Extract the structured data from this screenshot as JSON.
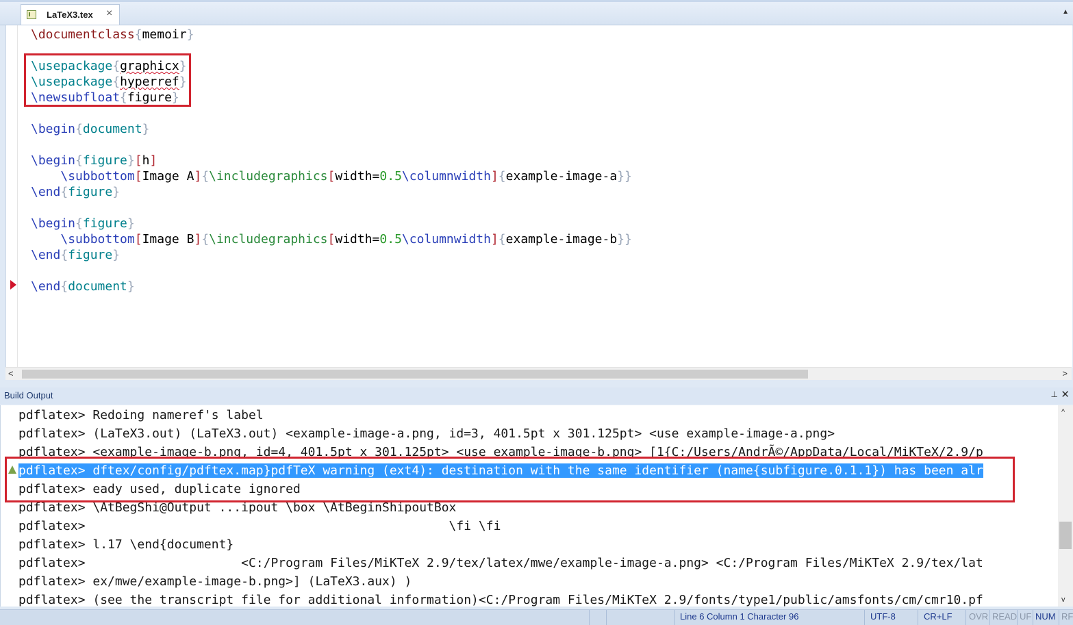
{
  "tab": {
    "label": "LaTeX3.tex"
  },
  "editor": {
    "lines": [
      {
        "parts": [
          {
            "t": "\\documentclass",
            "c": "kw-red"
          },
          {
            "t": "{",
            "c": "br-gray"
          },
          {
            "t": "memoir",
            "c": ""
          },
          {
            "t": "}",
            "c": "br-gray"
          }
        ]
      },
      {
        "parts": []
      },
      {
        "parts": [
          {
            "t": "\\usepackage",
            "c": "kw-teal"
          },
          {
            "t": "{",
            "c": "br-gray"
          },
          {
            "t": "graphicx",
            "c": "squiggle"
          },
          {
            "t": "}",
            "c": "br-gray"
          }
        ]
      },
      {
        "parts": [
          {
            "t": "\\usepackage",
            "c": "kw-teal"
          },
          {
            "t": "{",
            "c": "br-gray"
          },
          {
            "t": "hyperref",
            "c": "squiggle"
          },
          {
            "t": "}",
            "c": "br-gray"
          }
        ]
      },
      {
        "parts": [
          {
            "t": "\\newsubfloat",
            "c": "kw-blue"
          },
          {
            "t": "{",
            "c": "br-gray"
          },
          {
            "t": "figure",
            "c": ""
          },
          {
            "t": "}",
            "c": "br-gray"
          }
        ]
      },
      {
        "parts": []
      },
      {
        "parts": [
          {
            "t": "\\begin",
            "c": "kw-blue"
          },
          {
            "t": "{",
            "c": "br-gray"
          },
          {
            "t": "document",
            "c": "kw-teal"
          },
          {
            "t": "}",
            "c": "br-gray"
          }
        ]
      },
      {
        "parts": []
      },
      {
        "parts": [
          {
            "t": "\\begin",
            "c": "kw-blue"
          },
          {
            "t": "{",
            "c": "br-gray"
          },
          {
            "t": "figure",
            "c": "kw-teal"
          },
          {
            "t": "}",
            "c": "br-gray"
          },
          {
            "t": "[",
            "c": "br-red"
          },
          {
            "t": "h",
            "c": ""
          },
          {
            "t": "]",
            "c": "br-red"
          }
        ]
      },
      {
        "parts": [
          {
            "t": "    ",
            "c": ""
          },
          {
            "t": "\\subbottom",
            "c": "kw-blue"
          },
          {
            "t": "[",
            "c": "br-red"
          },
          {
            "t": "Image A",
            "c": ""
          },
          {
            "t": "]",
            "c": "br-red"
          },
          {
            "t": "{",
            "c": "br-gray"
          },
          {
            "t": "\\includegraphics",
            "c": "kw-green"
          },
          {
            "t": "[",
            "c": "br-red"
          },
          {
            "t": "width=",
            "c": ""
          },
          {
            "t": "0.5",
            "c": "num"
          },
          {
            "t": "\\columnwidth",
            "c": "kw-blue"
          },
          {
            "t": "]",
            "c": "br-red"
          },
          {
            "t": "{",
            "c": "br-gray"
          },
          {
            "t": "example-image-a",
            "c": ""
          },
          {
            "t": "}}",
            "c": "br-gray"
          }
        ]
      },
      {
        "parts": [
          {
            "t": "\\end",
            "c": "kw-blue"
          },
          {
            "t": "{",
            "c": "br-gray"
          },
          {
            "t": "figure",
            "c": "kw-teal"
          },
          {
            "t": "}",
            "c": "br-gray"
          }
        ]
      },
      {
        "parts": []
      },
      {
        "parts": [
          {
            "t": "\\begin",
            "c": "kw-blue"
          },
          {
            "t": "{",
            "c": "br-gray"
          },
          {
            "t": "figure",
            "c": "kw-teal"
          },
          {
            "t": "}",
            "c": "br-gray"
          }
        ]
      },
      {
        "parts": [
          {
            "t": "    ",
            "c": ""
          },
          {
            "t": "\\subbottom",
            "c": "kw-blue"
          },
          {
            "t": "[",
            "c": "br-red"
          },
          {
            "t": "Image B",
            "c": ""
          },
          {
            "t": "]",
            "c": "br-red"
          },
          {
            "t": "{",
            "c": "br-gray"
          },
          {
            "t": "\\includegraphics",
            "c": "kw-green"
          },
          {
            "t": "[",
            "c": "br-red"
          },
          {
            "t": "width=",
            "c": ""
          },
          {
            "t": "0.5",
            "c": "num"
          },
          {
            "t": "\\columnwidth",
            "c": "kw-blue"
          },
          {
            "t": "]",
            "c": "br-red"
          },
          {
            "t": "{",
            "c": "br-gray"
          },
          {
            "t": "example-image-b",
            "c": ""
          },
          {
            "t": "}}",
            "c": "br-gray"
          }
        ]
      },
      {
        "parts": [
          {
            "t": "\\end",
            "c": "kw-blue"
          },
          {
            "t": "{",
            "c": "br-gray"
          },
          {
            "t": "figure",
            "c": "kw-teal"
          },
          {
            "t": "}",
            "c": "br-gray"
          }
        ]
      },
      {
        "parts": []
      },
      {
        "parts": [
          {
            "t": "\\end",
            "c": "kw-blue"
          },
          {
            "t": "{",
            "c": "br-gray"
          },
          {
            "t": "document",
            "c": "kw-teal"
          },
          {
            "t": "}",
            "c": "br-gray"
          }
        ]
      }
    ]
  },
  "output": {
    "title": "Build Output",
    "lines": [
      "pdflatex> Redoing nameref's label",
      "pdflatex> (LaTeX3.out) (LaTeX3.out) <example-image-a.png, id=3, 401.5pt x 301.125pt> <use example-image-a.png>",
      "pdflatex> <example-image-b.png, id=4, 401.5pt x 301.125pt> <use example-image-b.png> [1{C:/Users/AndrÃ©/AppData/Local/MiKTeX/2.9/p",
      "pdflatex> dftex/config/pdftex.map}pdfTeX warning (ext4): destination with the same identifier (name{subfigure.0.1.1}) has been alr",
      "pdflatex> eady used, duplicate ignored",
      "pdflatex> \\AtBegShi@Output ...ipout \\box \\AtBeginShipoutBox",
      "pdflatex>                                                 \\fi \\fi",
      "pdflatex> l.17 \\end{document}",
      "pdflatex>                     <C:/Program Files/MiKTeX 2.9/tex/latex/mwe/example-image-a.png> <C:/Program Files/MiKTeX 2.9/tex/lat",
      "pdflatex> ex/mwe/example-image-b.png>] (LaTeX3.aux) )",
      "pdflatex> (see the transcript file for additional information)<C:/Program Files/MiKTeX 2.9/fonts/type1/public/amsfonts/cm/cmr10.pf"
    ],
    "selected_line": 3
  },
  "status": {
    "position": "Line 6 Column 1 Character 96",
    "encoding": "UTF-8",
    "line_ending": "CR+LF",
    "ovr": "OVR",
    "read": "READ",
    "uf": "UF",
    "num": "NUM",
    "rf": "RF"
  },
  "icons": {
    "tab": "tex-file-icon",
    "close": "close-icon",
    "pin": "pin-icon",
    "bookmark": "bookmark-marker-icon",
    "warning": "warning-icon"
  }
}
